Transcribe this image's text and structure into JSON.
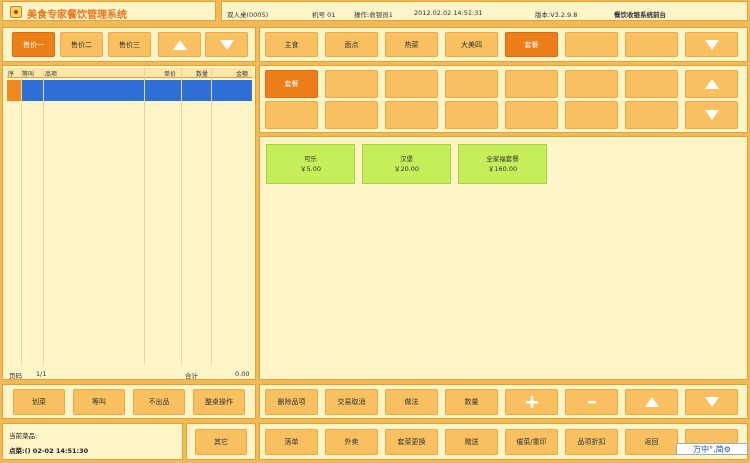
{
  "app": {
    "title": "美食专家餐饮管理系统"
  },
  "status_bar": {
    "table": "双人桌(0005)",
    "machine": "机号 01",
    "operator": "操作:收银员1",
    "datetime": "2012.02.02 14:51:31",
    "version": "版本:V3.2.9.8",
    "app_name": "餐饮收银系统前台"
  },
  "price_buttons": [
    "售价一",
    "售价二",
    "售价三"
  ],
  "order_table": {
    "columns": [
      "序",
      "等叫",
      "品项",
      "单价",
      "数量",
      "金额"
    ],
    "footer": {
      "page_label": "页码",
      "page_value": "1/1",
      "total_label": "合计",
      "total_value": "0.00"
    }
  },
  "categories": [
    "主食",
    "面点",
    "热菜",
    "大美四",
    "套餐"
  ],
  "subcategories": [
    "套餐"
  ],
  "dishes": [
    {
      "name": "可乐",
      "price": "￥5.00"
    },
    {
      "name": "汉堡",
      "price": "￥20.00"
    },
    {
      "name": "全家福套餐",
      "price": "￥160.00"
    }
  ],
  "left_actions": [
    "划菜",
    "等叫",
    "不出品",
    "整桌操作"
  ],
  "current_item": {
    "label": "当前菜品:",
    "info": "点菜:() 02-02 14:51:30"
  },
  "other_button": "其它",
  "action_row1": [
    "删除品项",
    "交易取消",
    "做法",
    "数量"
  ],
  "action_row2": [
    "落单",
    "外卖",
    "套菜更换",
    "赠送",
    "催菜/重印",
    "品项折扣",
    "返回"
  ],
  "tray": {
    "text": "万中°,简⚙"
  }
}
